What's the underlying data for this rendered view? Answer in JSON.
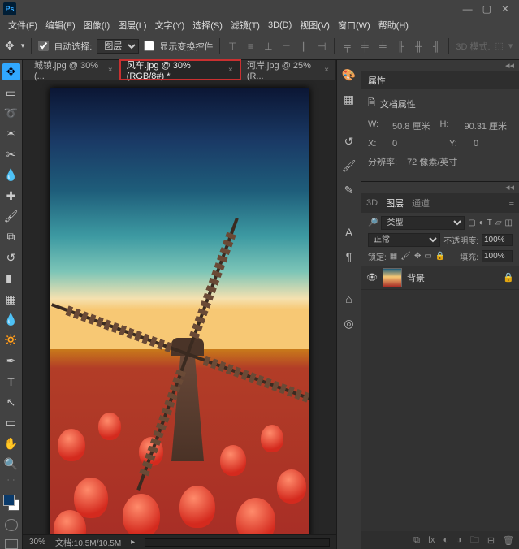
{
  "app": {
    "logo": "Ps"
  },
  "window": {
    "min": "—",
    "max": "▢",
    "close": "✕"
  },
  "menu": {
    "file": "文件(F)",
    "edit": "编辑(E)",
    "image": "图像(I)",
    "layer": "图层(L)",
    "type": "文字(Y)",
    "select": "选择(S)",
    "filter": "滤镜(T)",
    "threeD": "3D(D)",
    "view": "视图(V)",
    "window": "窗口(W)",
    "help": "帮助(H)"
  },
  "options": {
    "autoSelectLabel": "自动选择:",
    "autoSelectTarget": "图层",
    "showTransformLabel": "显示变换控件",
    "threeDMode": "3D 模式:"
  },
  "tabs": [
    {
      "label": "城镇.jpg @ 30% (...",
      "active": false
    },
    {
      "label": "风车.jpg @ 30%(RGB/8#) *",
      "active": true,
      "highlight": true
    },
    {
      "label": "河岸.jpg @ 25%(R...",
      "active": false
    }
  ],
  "status": {
    "zoom": "30%",
    "docinfo": "文档:10.5M/10.5M"
  },
  "properties": {
    "panelTitle": "属性",
    "docPropsLabel": "文档属性",
    "wLabel": "W:",
    "wValue": "50.8 厘米",
    "hLabel": "H:",
    "hValue": "90.31 厘米",
    "xLabel": "X:",
    "xValue": "0",
    "yLabel": "Y:",
    "yValue": "0",
    "resLabel": "分辨率:",
    "resValue": "72 像素/英寸"
  },
  "layers": {
    "tab3D": "3D",
    "tabLayers": "图层",
    "tabChannels": "通道",
    "kindLabel": "类型",
    "blendMode": "正常",
    "opacityLabel": "不透明度:",
    "opacityValue": "100%",
    "lockLabel": "锁定:",
    "fillLabel": "填充:",
    "fillValue": "100%",
    "bgLayer": "背景"
  },
  "icons": {
    "move": "✥",
    "dropdown": "▾",
    "checkbox": "☐",
    "tabClose": "×",
    "eye": "👁",
    "lock": "🔒",
    "link": "⧉",
    "fx": "fx",
    "mask": "◐",
    "adjust": "◑",
    "folder": "🗀",
    "new": "⊞",
    "trash": "🗑",
    "panelArrow": "◂◂"
  }
}
